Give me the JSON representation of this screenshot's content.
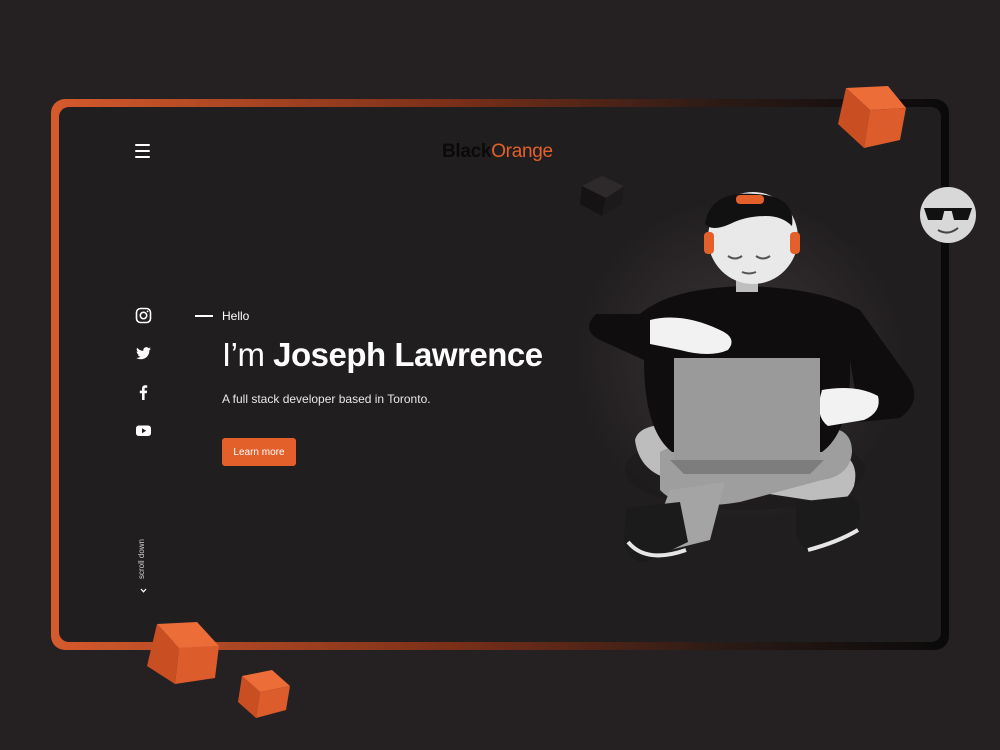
{
  "brand": {
    "part1": "Black",
    "part2": "Orange"
  },
  "hero": {
    "greeting": "Hello",
    "intro": "I’m",
    "name": "Joseph Lawrence",
    "tagline": "A full stack developer based in Toronto.",
    "cta_label": "Learn more"
  },
  "social": [
    "instagram-icon",
    "twitter-icon",
    "facebook-icon",
    "youtube-icon"
  ],
  "scroll": {
    "label": "scroll down"
  },
  "colors": {
    "accent": "#e4602a",
    "background": "#252122",
    "panel": "#211e1f"
  }
}
